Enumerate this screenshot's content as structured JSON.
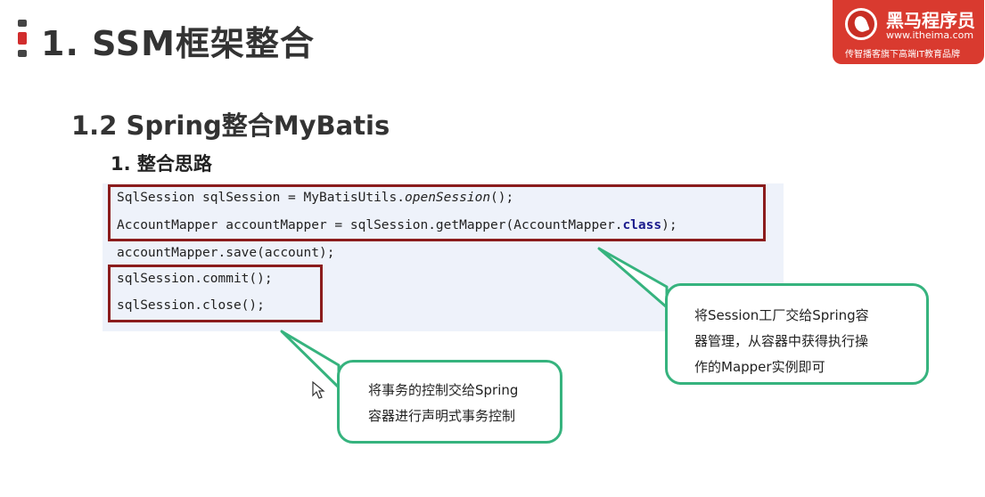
{
  "slide": {
    "title": "1. SSM框架整合",
    "subtitle": "1.2 Spring整合MyBatis",
    "section": "1. 整合思路"
  },
  "logo": {
    "name": "黑马程序员",
    "url": "www.itheima.com",
    "slogan": "传智播客旗下高端IT教育品牌"
  },
  "code": {
    "line1": {
      "a": "SqlSession sqlSession = MyBatisUtils.",
      "b": "openSession",
      "c": "();"
    },
    "line2": {
      "a": "AccountMapper accountMapper = sqlSession.getMapper(AccountMapper.",
      "b": "class",
      "c": ");"
    },
    "line3": "accountMapper.save(account);",
    "line4": "sqlSession.commit();",
    "line5": "sqlSession.close();"
  },
  "callouts": {
    "right": {
      "line1": "将Session工厂交给Spring容",
      "line2": "器管理，从容器中获得执行操",
      "line3": "作的Mapper实例即可"
    },
    "bottom": {
      "line1": "将事务的控制交给Spring",
      "line2": "容器进行声明式事务控制"
    }
  },
  "colors": {
    "accent_red": "#d93a2f",
    "highlight_box": "#8b1c1c",
    "callout_border": "#36b37e",
    "code_background": "#eef2fa"
  }
}
